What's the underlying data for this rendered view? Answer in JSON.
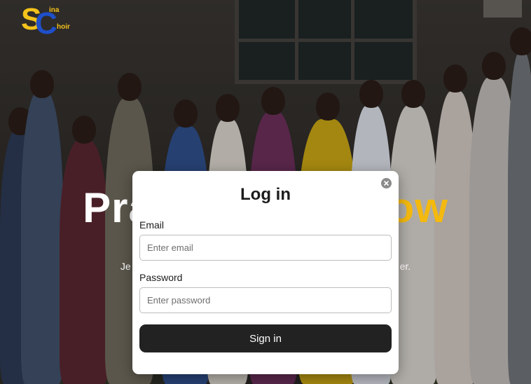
{
  "logo": {
    "monogram_first": "S",
    "monogram_second": "C",
    "word_top": "ina",
    "word_bottom": "hoir"
  },
  "hero": {
    "title_left": "Prais",
    "title_right": "rrow",
    "subtitle_left": "Je",
    "subtitle_right": "er."
  },
  "login_modal": {
    "title": "Log in",
    "close_icon": "close-icon",
    "email_label": "Email",
    "email_placeholder": "Enter email",
    "email_value": "",
    "password_label": "Password",
    "password_placeholder": "Enter password",
    "password_value": "",
    "submit_label": "Sign in"
  },
  "colors": {
    "brand_yellow": "#f4c21b",
    "brand_blue": "#1f4fc9",
    "hero_accent": "#f4b90e",
    "button_dark": "#222222",
    "close_gray": "#8b8b8b"
  }
}
